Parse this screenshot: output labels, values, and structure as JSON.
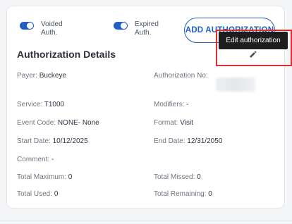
{
  "toggles": [
    {
      "label": "Voided Auth.",
      "on": true
    },
    {
      "label": "Expired Auth.",
      "on": true
    }
  ],
  "add_button_label": "ADD AUTHORIZATION",
  "section_title": "Authorization Details",
  "tooltip_text": "Edit authorization",
  "fields": {
    "payer": {
      "label": "Payer:",
      "value": "Buckeye"
    },
    "authorization_no": {
      "label": "Authorization No:",
      "value": ""
    },
    "service": {
      "label": "Service:",
      "value": "T1000"
    },
    "modifiers": {
      "label": "Modifiers:",
      "value": "-"
    },
    "event_code": {
      "label": "Event Code:",
      "value": "NONE- None"
    },
    "format": {
      "label": "Format:",
      "value": "Visit"
    },
    "start_date": {
      "label": "Start Date:",
      "value": "10/12/2025"
    },
    "end_date": {
      "label": "End Date:",
      "value": "12/31/2050"
    },
    "comment": {
      "label": "Comment:",
      "value": "-"
    },
    "total_maximum": {
      "label": "Total Maximum:",
      "value": "0"
    },
    "total_missed": {
      "label": "Total Missed:",
      "value": "0"
    },
    "total_used": {
      "label": "Total Used:",
      "value": "0"
    },
    "total_remaining": {
      "label": "Total Remaining:",
      "value": "0"
    }
  },
  "colors": {
    "accent": "#1f5fc6",
    "highlight": "#e0302e",
    "tooltip_bg": "#1e1e1e"
  },
  "icons": {
    "edit": "pencil-icon"
  }
}
